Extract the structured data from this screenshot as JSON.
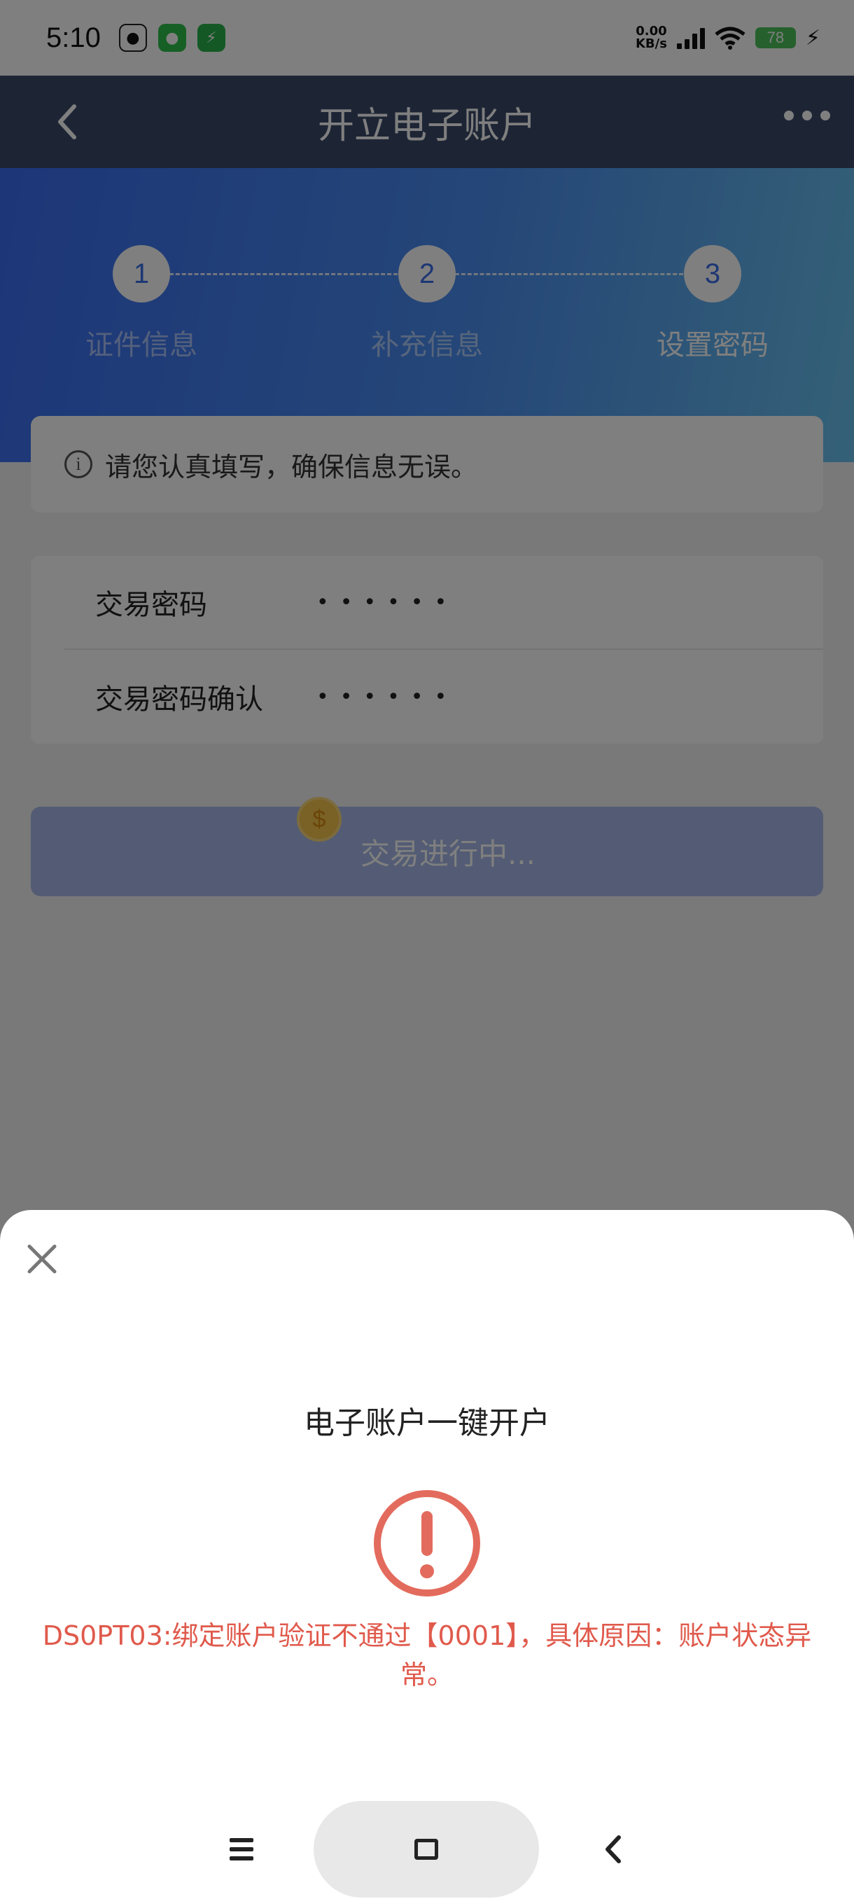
{
  "status_bar": {
    "time": "5:10",
    "net_speed_value": "0.00",
    "net_speed_unit": "KB/s",
    "battery": "78",
    "app_icons": [
      "qq-icon",
      "wechat-icon",
      "green-app-icon"
    ]
  },
  "header": {
    "title": "开立电子账户",
    "back_icon": "chevron-left-icon",
    "more_icon": "more-dots-icon"
  },
  "steps": [
    {
      "number": "1",
      "label": "证件信息",
      "active": false
    },
    {
      "number": "2",
      "label": "补充信息",
      "active": false
    },
    {
      "number": "3",
      "label": "设置密码",
      "active": true
    }
  ],
  "notice": {
    "icon": "info-icon",
    "text": "请您认真填写，确保信息无误。"
  },
  "form": {
    "password_label": "交易密码",
    "password_value": "••••••",
    "confirm_label": "交易密码确认",
    "confirm_value": "••••••"
  },
  "submit": {
    "label": "交易进行中..."
  },
  "sheet": {
    "title": "电子账户一键开户",
    "error_message": "DS0PT03:绑定账户验证不通过【0001】，具体原因：账户状态异常。",
    "close_icon": "close-icon",
    "status_icon": "exclamation-icon"
  },
  "colors": {
    "nav_bg": "#3b4a6b",
    "banner_start": "#3a6cf0",
    "banner_end": "#6ac2ee",
    "error": "#e05a4c",
    "button_disabled": "#a6b9e8"
  }
}
